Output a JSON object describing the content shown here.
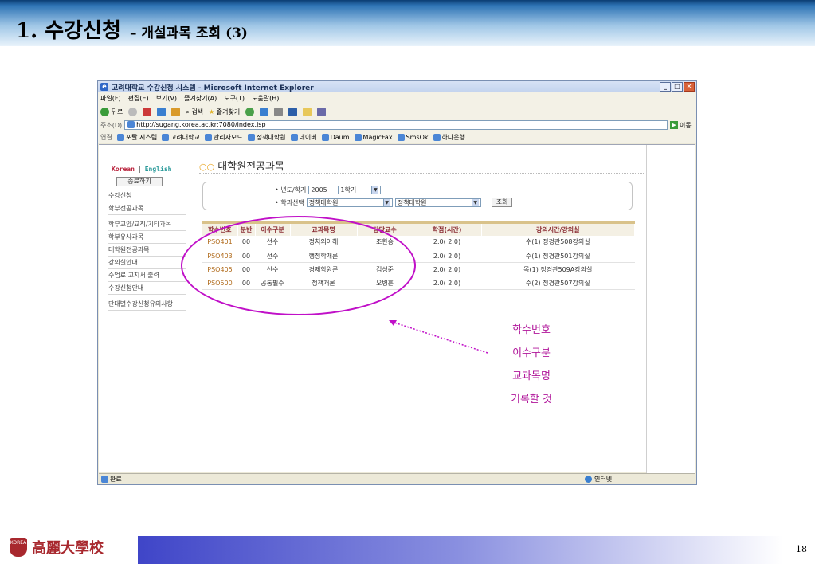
{
  "slide": {
    "title": "1. 수강신청",
    "subtitle": "– 개설과목 조회 (3)",
    "page_number": "18",
    "university_name": "高麗大學校",
    "crest_text": "KOREA"
  },
  "browser": {
    "window_title": "고려대학교 수강신청 시스템 - Microsoft Internet Explorer",
    "menu": [
      "파일(F)",
      "편집(E)",
      "보기(V)",
      "즐겨찾기(A)",
      "도구(T)",
      "도움말(H)"
    ],
    "toolbar": {
      "back": "뒤로",
      "search": "검색",
      "favorites": "즐겨찾기"
    },
    "address_label": "주소(D)",
    "url": "http://sugang.korea.ac.kr:7080/index.jsp",
    "go_label": "이동",
    "links_label": "연결",
    "links": [
      "포탈 시스템",
      "고려대학교",
      "관리자모드",
      "정책대학원",
      "네이버",
      "Daum",
      "MagicFax",
      "SmsOk",
      "하나은행"
    ],
    "status_left": "완료",
    "status_zone": "인터넷"
  },
  "nav": {
    "lang_korean": "Korean",
    "lang_sep": "|",
    "lang_english": "English",
    "exit_button": "종료하기",
    "items": [
      "수강신청",
      "학부전공과목",
      "학부교양/교직/기타과목",
      "학부유사과목",
      "대학원전공과목",
      "강의실안내",
      "수업료 고지서 출력",
      "수강신청안내",
      "단대별수강신청유의사항"
    ]
  },
  "page": {
    "heading_marker": "○○",
    "heading": "대학원전공과목"
  },
  "search": {
    "year_term_label": "• 년도/학기",
    "year": "2005",
    "term": "1학기",
    "dept_label": "• 학과선택",
    "dept1": "정책대학원",
    "dept2": "정책대학원",
    "submit": "조회"
  },
  "table": {
    "headers": [
      "학수번호",
      "분반",
      "이수구분",
      "교과목명",
      "담당교수",
      "학점(시간)",
      "강의시간/강의실"
    ],
    "rows": [
      [
        "PSO401",
        "00",
        "선수",
        "정치의이해",
        "조한승",
        "2.0( 2.0)",
        "수(1) 정경관508강의실"
      ],
      [
        "PSO403",
        "00",
        "선수",
        "행정학개론",
        "",
        "2.0( 2.0)",
        "수(1) 정경관501강의실"
      ],
      [
        "PSO405",
        "00",
        "선수",
        "경제학원론",
        "김성준",
        "2.0( 2.0)",
        "목(1) 정경관509A강의실"
      ],
      [
        "PSO500",
        "00",
        "공통필수",
        "정책개론",
        "오병훈",
        "2.0( 2.0)",
        "수(2) 정경관507강의실"
      ]
    ]
  },
  "annotation": {
    "lines": [
      "학수번호",
      "이수구분",
      "교과목명",
      "기록할 것"
    ],
    "color": "#c010c8"
  },
  "colors": {
    "header_gradient_top": "#0b3d73",
    "table_header_text": "#8a2b32",
    "course_code": "#b06a1a",
    "footer_bar": "#3f45c8",
    "crest": "#a8282e"
  }
}
